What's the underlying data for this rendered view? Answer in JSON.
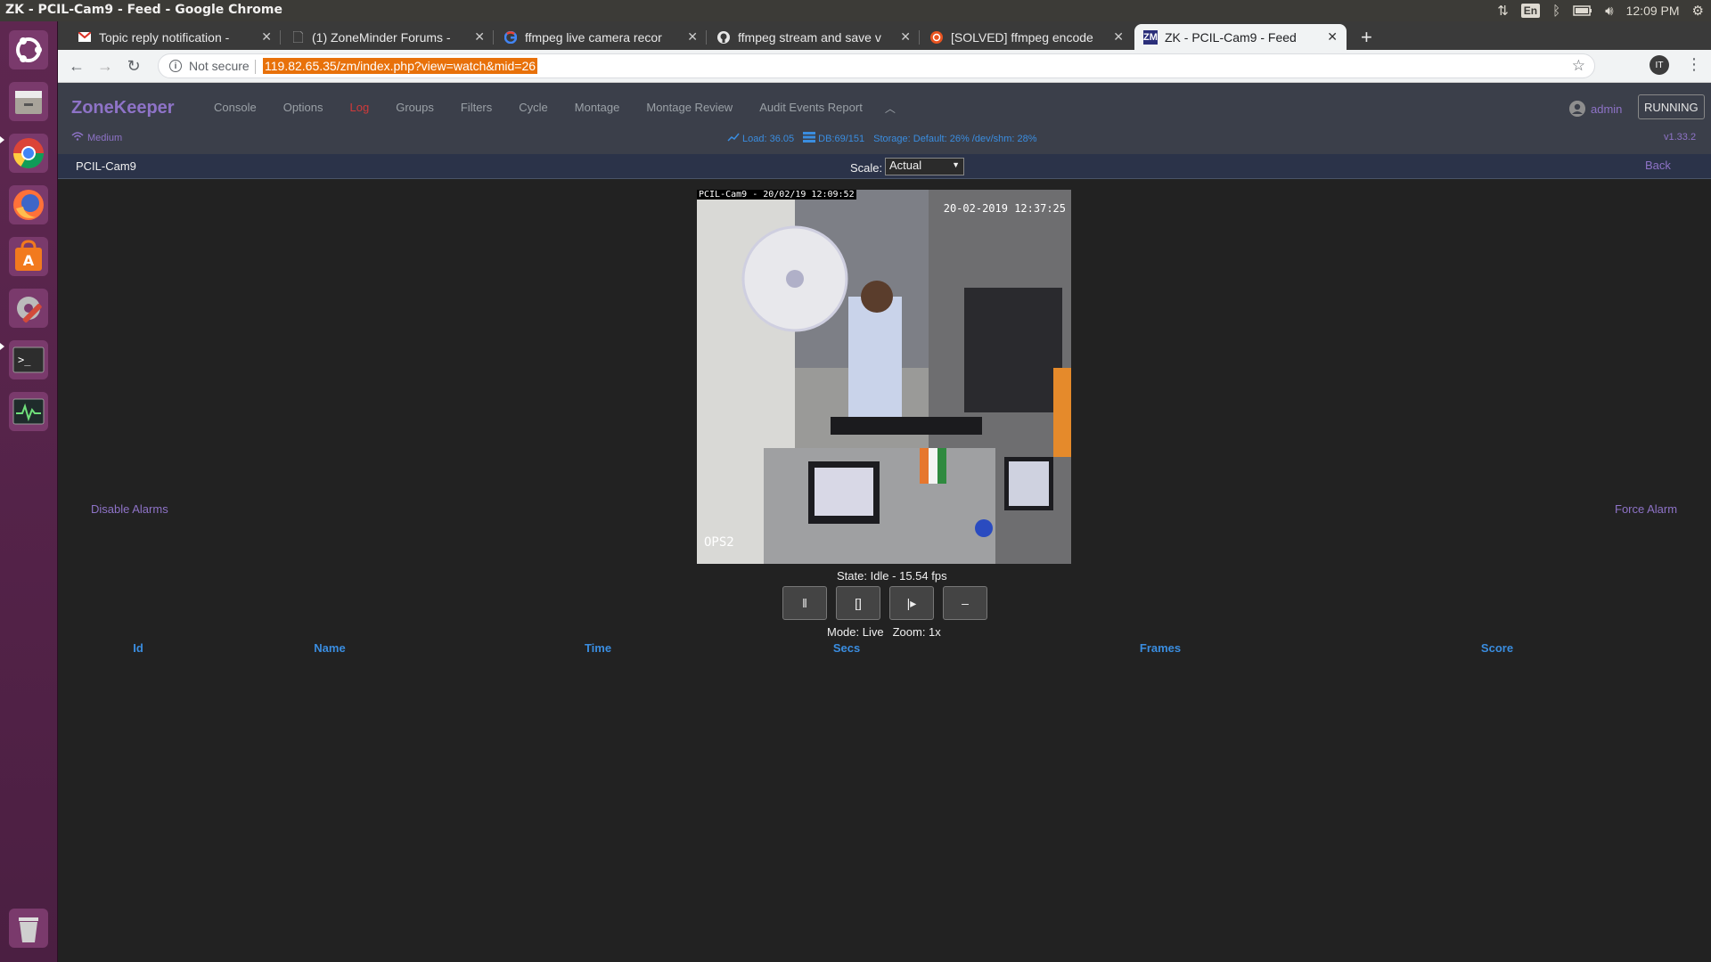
{
  "window": {
    "title": "ZK - PCIL-Cam9 - Feed - Google Chrome"
  },
  "system_tray": {
    "keyboard_layout": "En",
    "clock": "12:09 PM"
  },
  "launcher": {
    "items": [
      "ubuntu-dash",
      "files",
      "chrome",
      "firefox",
      "software-center",
      "system-settings",
      "terminal",
      "system-monitor",
      "trash"
    ]
  },
  "tabs": [
    {
      "title": "Topic reply notification - ",
      "favicon": "gmail-icon"
    },
    {
      "title": "(1) ZoneMinder Forums - ",
      "favicon": "page-icon"
    },
    {
      "title": "ffmpeg live camera recor",
      "favicon": "google-icon"
    },
    {
      "title": "ffmpeg stream and save v",
      "favicon": "github-icon"
    },
    {
      "title": "[SOLVED] ffmpeg encode",
      "favicon": "ubuntu-icon"
    },
    {
      "title": "ZK - PCIL-Cam9 - Feed",
      "favicon": "zm-icon",
      "active": true
    }
  ],
  "omnibox": {
    "security": "Not secure",
    "url": "119.82.65.35/zm/index.php?view=watch&mid=26"
  },
  "profile": {
    "initials": "IT"
  },
  "zm": {
    "brand": "ZoneKeeper",
    "menu": [
      "Console",
      "Options",
      "Log",
      "Groups",
      "Filters",
      "Cycle",
      "Montage",
      "Montage Review",
      "Audit Events Report"
    ],
    "user": "admin",
    "run_state": "RUNNING",
    "bandwidth": "Medium",
    "load": "Load: 36.05",
    "db": "DB:69/151",
    "storage": "Storage: Default: 26% /dev/shm: 28%",
    "version": "v1.33.2"
  },
  "monitor": {
    "name": "PCIL-Cam9",
    "scale_label": "Scale:",
    "scale_value": "Actual",
    "back": "Back",
    "overlay_top": "PCIL-Cam9 - 20/02/19 12:09:52",
    "overlay_time": "20-02-2019 12:37:25",
    "overlay_cam": "OPS2",
    "disable_alarms": "Disable Alarms",
    "force_alarm": "Force Alarm",
    "state": "State: Idle - 15.54 fps",
    "mode": "Mode: Live",
    "zoom": "Zoom: 1x"
  },
  "controls": [
    {
      "glyph": "‖",
      "name": "pause"
    },
    {
      "glyph": "[]",
      "name": "stop"
    },
    {
      "glyph": "|▸",
      "name": "play"
    },
    {
      "glyph": "–",
      "name": "zoom-out"
    }
  ],
  "events_table": {
    "columns": [
      "Id",
      "Name",
      "Time",
      "Secs",
      "Frames",
      "Score"
    ]
  }
}
